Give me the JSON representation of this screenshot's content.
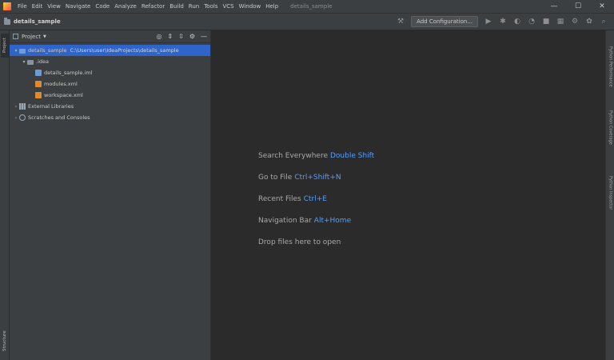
{
  "menu": {
    "items": [
      "File",
      "Edit",
      "View",
      "Navigate",
      "Code",
      "Analyze",
      "Refactor",
      "Build",
      "Run",
      "Tools",
      "VCS",
      "Window",
      "Help"
    ],
    "project_title": "details_sample"
  },
  "window_controls": {
    "minimize": "—",
    "maximize": "☐",
    "close": "✕"
  },
  "navbar": {
    "project_name": "details_sample",
    "add_configuration": "Add Configuration..."
  },
  "left_strip": {
    "project_tab": "Project",
    "structure_tab": "Structure"
  },
  "panel": {
    "title": "Project",
    "tree": [
      {
        "label": "details_sample",
        "path": "C:\\Users\\user\\IdeaProjects\\details_sample"
      },
      {
        "label": ".idea"
      },
      {
        "label": "details_sample.iml"
      },
      {
        "label": "modules.xml"
      },
      {
        "label": "workspace.xml"
      },
      {
        "label": "External Libraries"
      },
      {
        "label": "Scratches and Consoles"
      }
    ]
  },
  "editor": {
    "hints": [
      {
        "text": "Search Everywhere",
        "key": "Double Shift"
      },
      {
        "text": "Go to File",
        "key": "Ctrl+Shift+N"
      },
      {
        "text": "Recent Files",
        "key": "Ctrl+E"
      },
      {
        "text": "Navigation Bar",
        "key": "Alt+Home"
      },
      {
        "text": "Drop files here to open",
        "key": ""
      }
    ]
  },
  "right_strip": {
    "tabs": [
      "Python Performance",
      "Python Coverage",
      "Python Inspector"
    ]
  },
  "colors": {
    "selection": "#2f65ca",
    "shortcut_key": "#589df6",
    "editor_bg": "#2b2b2b",
    "panel_bg": "#3c3f41"
  }
}
